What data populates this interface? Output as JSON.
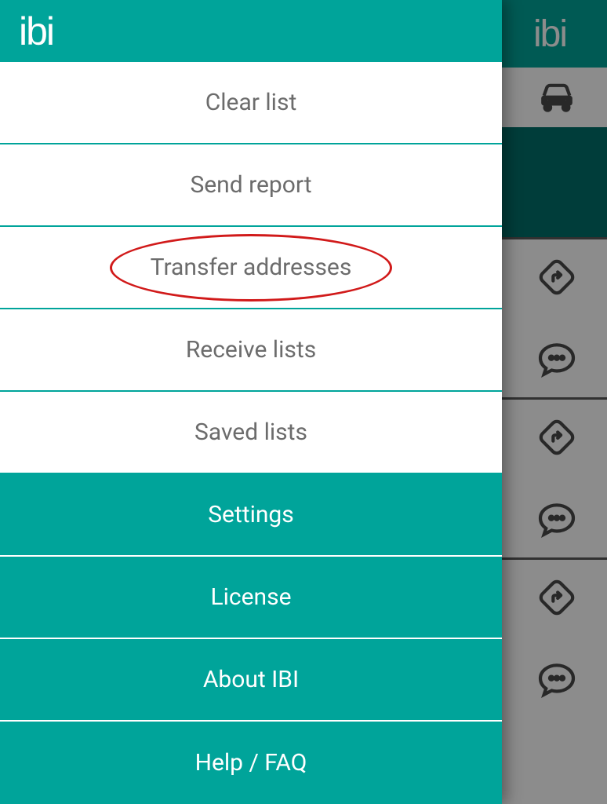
{
  "brand": {
    "logo_text": "ibi"
  },
  "drawer": {
    "menu": {
      "light_items": [
        {
          "label": "Clear list",
          "highlighted": false
        },
        {
          "label": "Send report",
          "highlighted": false
        },
        {
          "label": "Transfer addresses",
          "highlighted": true
        },
        {
          "label": "Receive lists",
          "highlighted": false
        },
        {
          "label": "Saved lists",
          "highlighted": false
        }
      ],
      "dark_items": [
        {
          "label": "Settings"
        },
        {
          "label": "License"
        },
        {
          "label": "About IBI"
        },
        {
          "label": "Help / FAQ"
        }
      ]
    }
  },
  "background": {
    "header_icons": [
      "car-icon"
    ],
    "row_icons": [
      "nav-diamond-icon",
      "chat-bubble-icon"
    ]
  },
  "annotation": {
    "type": "ellipse",
    "color": "#d11a1a",
    "target_label": "Transfer addresses"
  },
  "colors": {
    "teal": "#00a49a",
    "teal_dark": "#006f6a",
    "text_muted": "#6c6c6c",
    "annotation_red": "#d11a1a"
  }
}
